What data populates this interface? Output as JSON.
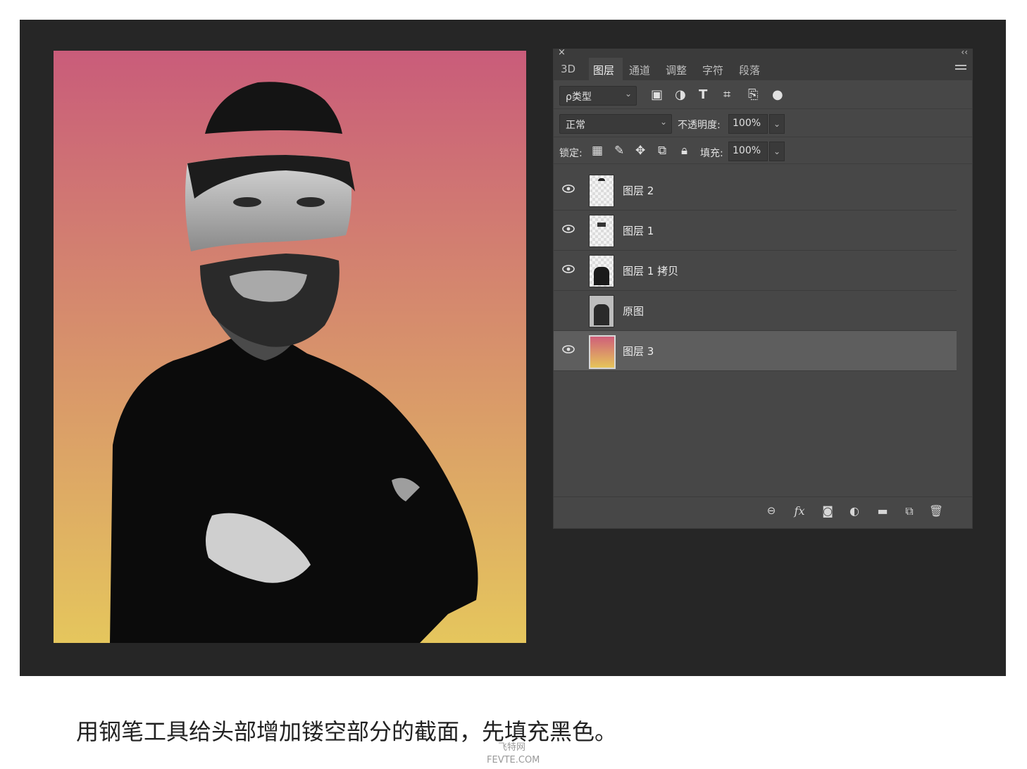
{
  "panel": {
    "tabs": [
      "3D",
      "图层",
      "通道",
      "调整",
      "字符",
      "段落"
    ],
    "active_tab": "图层",
    "filter": {
      "value": "ρ类型"
    },
    "blend_mode": "正常",
    "opacity_label": "不透明度:",
    "opacity_value": "100%",
    "lock_label": "锁定:",
    "fill_label": "填充:",
    "fill_value": "100%",
    "layers": [
      {
        "name": "图层 2",
        "visible": true,
        "selected": false
      },
      {
        "name": "图层 1",
        "visible": true,
        "selected": false
      },
      {
        "name": "图层 1 拷贝",
        "visible": true,
        "selected": false
      },
      {
        "name": "原图",
        "visible": false,
        "selected": false
      },
      {
        "name": "图层 3",
        "visible": true,
        "selected": true
      }
    ],
    "footer_icons": [
      "link-icon",
      "fx-icon",
      "mask-icon",
      "adjustment-icon",
      "folder-icon",
      "new-layer-icon",
      "trash-icon"
    ],
    "fx_label": "fx"
  },
  "canvas": {
    "gradient_top": "#c95c7a",
    "gradient_bottom": "#e5c65d"
  },
  "caption": "用钢笔工具给头部增加镂空部分的截面，先填充黑色。",
  "watermark": {
    "line1": "飞特网",
    "line2": "FEVTE.COM"
  }
}
